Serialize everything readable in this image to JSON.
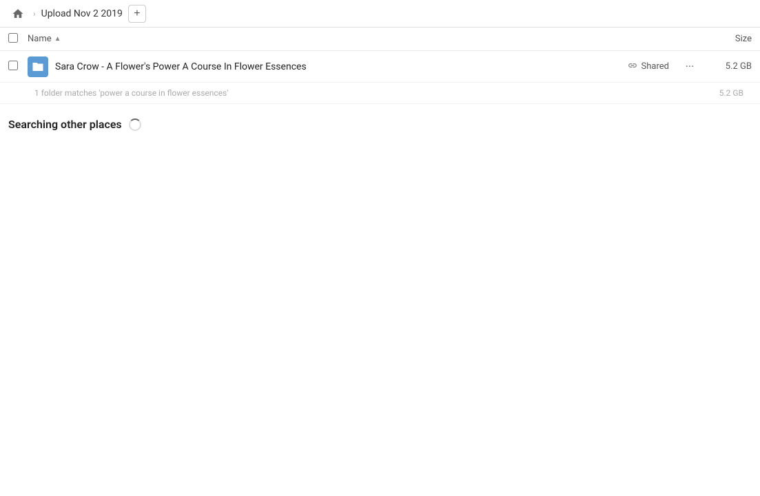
{
  "header": {
    "home_icon": "home",
    "breadcrumb_title": "Upload Nov 2 2019",
    "add_button_label": "+"
  },
  "columns": {
    "name_label": "Name",
    "sort_indicator": "▲",
    "size_label": "Size"
  },
  "file_row": {
    "icon_color": "#5b9bd5",
    "name": "Sara Crow - A Flower's Power A Course In Flower Essences",
    "shared_label": "Shared",
    "size": "5.2 GB"
  },
  "match_summary": {
    "text": "1 folder matches 'power a course in flower essences'",
    "size": "5.2 GB"
  },
  "searching": {
    "label": "Searching other places"
  }
}
